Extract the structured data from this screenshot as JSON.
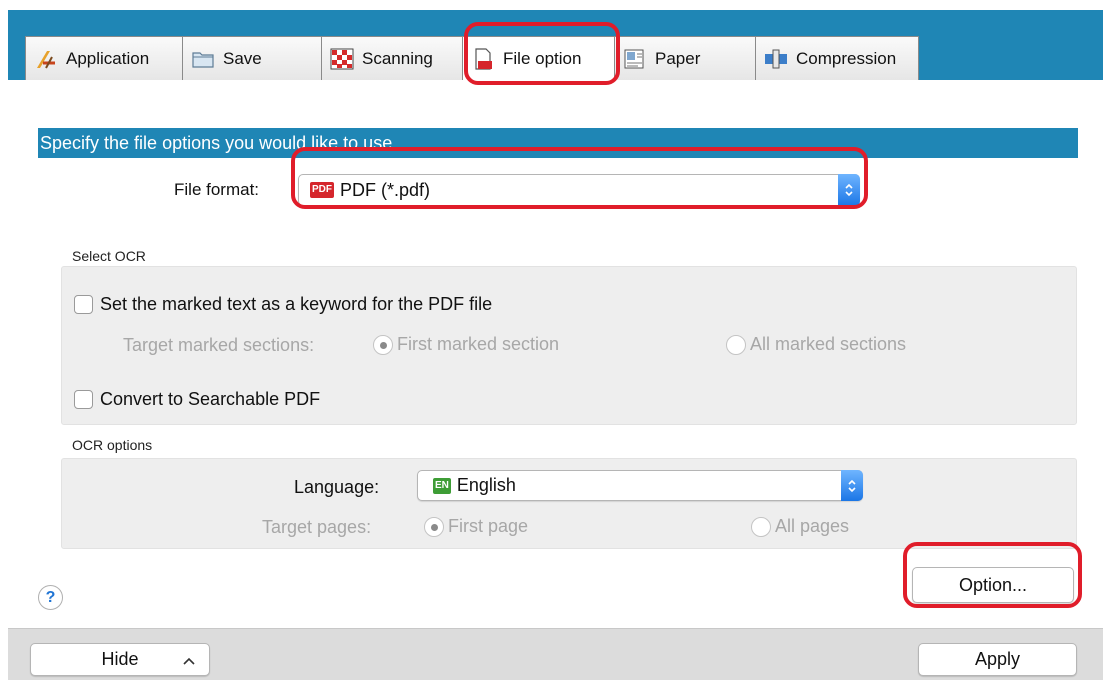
{
  "tabs": [
    {
      "label": "Application",
      "icon": "application-icon"
    },
    {
      "label": "Save",
      "icon": "folder-icon"
    },
    {
      "label": "Scanning",
      "icon": "scanning-icon"
    },
    {
      "label": "File option",
      "icon": "file-option-icon",
      "active": true
    },
    {
      "label": "Paper",
      "icon": "paper-icon"
    },
    {
      "label": "Compression",
      "icon": "compression-icon"
    }
  ],
  "banner": "Specify the file options you would like to use.",
  "file_format": {
    "label": "File format:",
    "badge": "PDF",
    "value": "PDF (*.pdf)"
  },
  "select_ocr": {
    "title": "Select OCR",
    "keyword_checkbox": {
      "label": "Set the marked text as a keyword for the PDF file",
      "checked": false
    },
    "target_marked": {
      "label": "Target marked sections:",
      "options": [
        "First marked section",
        "All marked sections"
      ],
      "selected": "First marked section"
    },
    "searchable_checkbox": {
      "label": "Convert to Searchable PDF",
      "checked": false
    }
  },
  "ocr_options": {
    "title": "OCR options",
    "language": {
      "label": "Language:",
      "badge": "EN",
      "value": "English"
    },
    "target_pages": {
      "label": "Target pages:",
      "options": [
        "First page",
        "All pages"
      ],
      "selected": "First page"
    }
  },
  "help_label": "?",
  "option_button": "Option...",
  "hide_button": "Hide",
  "apply_button": "Apply",
  "colors": {
    "accent": "#1f86b5",
    "highlight": "#e01d2a",
    "pdf_badge": "#d5262c",
    "en_badge": "#3e9d36"
  }
}
